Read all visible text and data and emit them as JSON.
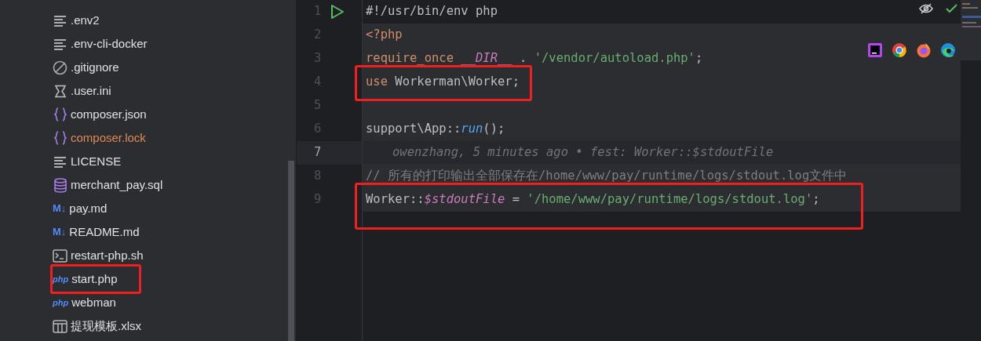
{
  "project_tree": {
    "items": [
      {
        "name": ".env2",
        "kind": "text",
        "modified": false,
        "highlighted": false
      },
      {
        "name": ".env-cli-docker",
        "kind": "text",
        "modified": false,
        "highlighted": false
      },
      {
        "name": ".gitignore",
        "kind": "ignore",
        "modified": false,
        "highlighted": false
      },
      {
        "name": ".user.ini",
        "kind": "ini",
        "modified": false,
        "highlighted": false
      },
      {
        "name": "composer.json",
        "kind": "json",
        "modified": false,
        "highlighted": false
      },
      {
        "name": "composer.lock",
        "kind": "json",
        "modified": true,
        "highlighted": false
      },
      {
        "name": "LICENSE",
        "kind": "text",
        "modified": false,
        "highlighted": false
      },
      {
        "name": "merchant_pay.sql",
        "kind": "sql",
        "modified": false,
        "highlighted": false
      },
      {
        "name": "pay.md",
        "kind": "markdown",
        "icon_text": "M↓",
        "modified": false,
        "highlighted": false
      },
      {
        "name": "README.md",
        "kind": "markdown",
        "icon_text": "M↓",
        "modified": false,
        "highlighted": false
      },
      {
        "name": "restart-php.sh",
        "kind": "shell",
        "modified": false,
        "highlighted": false
      },
      {
        "name": "start.php",
        "kind": "php",
        "icon_text": "php",
        "modified": false,
        "highlighted": true
      },
      {
        "name": "webman",
        "kind": "php",
        "icon_text": "php",
        "modified": false,
        "highlighted": false
      },
      {
        "name": "提现模板.xlsx",
        "kind": "sheet",
        "modified": false,
        "highlighted": false
      }
    ]
  },
  "editor": {
    "lines": [
      {
        "number": "1",
        "run_marker": true,
        "current": false,
        "highlighted": false,
        "tokens": [
          {
            "kind": "plain",
            "text": "#!/usr/bin/env php"
          }
        ]
      },
      {
        "number": "2",
        "run_marker": false,
        "current": false,
        "highlighted": false,
        "tokens": [
          {
            "kind": "keyword",
            "text": "<?php"
          }
        ]
      },
      {
        "number": "3",
        "run_marker": false,
        "current": false,
        "highlighted": false,
        "tokens": [
          {
            "kind": "keyword",
            "text": "require_once "
          },
          {
            "kind": "constant",
            "text": "__DIR__"
          },
          {
            "kind": "plain",
            "text": " . "
          },
          {
            "kind": "string",
            "text": "'/vendor/autoload.php'"
          },
          {
            "kind": "plain",
            "text": ";"
          }
        ]
      },
      {
        "number": "4",
        "run_marker": false,
        "current": false,
        "highlighted": true,
        "tokens": [
          {
            "kind": "keyword",
            "text": "use "
          },
          {
            "kind": "plain",
            "text": "Workerman\\Worker;"
          }
        ]
      },
      {
        "number": "5",
        "run_marker": false,
        "current": false,
        "highlighted": false
      },
      {
        "number": "6",
        "run_marker": false,
        "current": false,
        "highlighted": false,
        "tokens": [
          {
            "kind": "plain",
            "text": "support\\App::"
          },
          {
            "kind": "function",
            "text": "run"
          },
          {
            "kind": "plain",
            "text": "();"
          }
        ]
      },
      {
        "number": "7",
        "run_marker": false,
        "current": true,
        "highlighted": false,
        "tokens": [
          {
            "kind": "blame",
            "text": "owenzhang, 5 minutes ago • fest: Worker::$stdoutFile"
          }
        ]
      },
      {
        "number": "8",
        "run_marker": false,
        "current": false,
        "highlighted": false,
        "tokens": [
          {
            "kind": "comment",
            "text": "// 所有的打印输出全部保存在/home/www/pay/runtime/logs/stdout.log文件中"
          }
        ]
      },
      {
        "number": "9",
        "run_marker": false,
        "current": false,
        "highlighted": true,
        "tokens": [
          {
            "kind": "plain",
            "text": "Worker::"
          },
          {
            "kind": "variable",
            "text": "$stdoutFile"
          },
          {
            "kind": "plain",
            "text": " = "
          },
          {
            "kind": "string",
            "text": "'/home/www/pay/runtime/logs/stdout.log'"
          },
          {
            "kind": "plain",
            "text": ";"
          }
        ]
      }
    ],
    "browser_icons": [
      {
        "kind": "phpstorm"
      },
      {
        "kind": "chrome"
      },
      {
        "kind": "firefox"
      },
      {
        "kind": "edge"
      }
    ],
    "inspections_ok": true
  }
}
